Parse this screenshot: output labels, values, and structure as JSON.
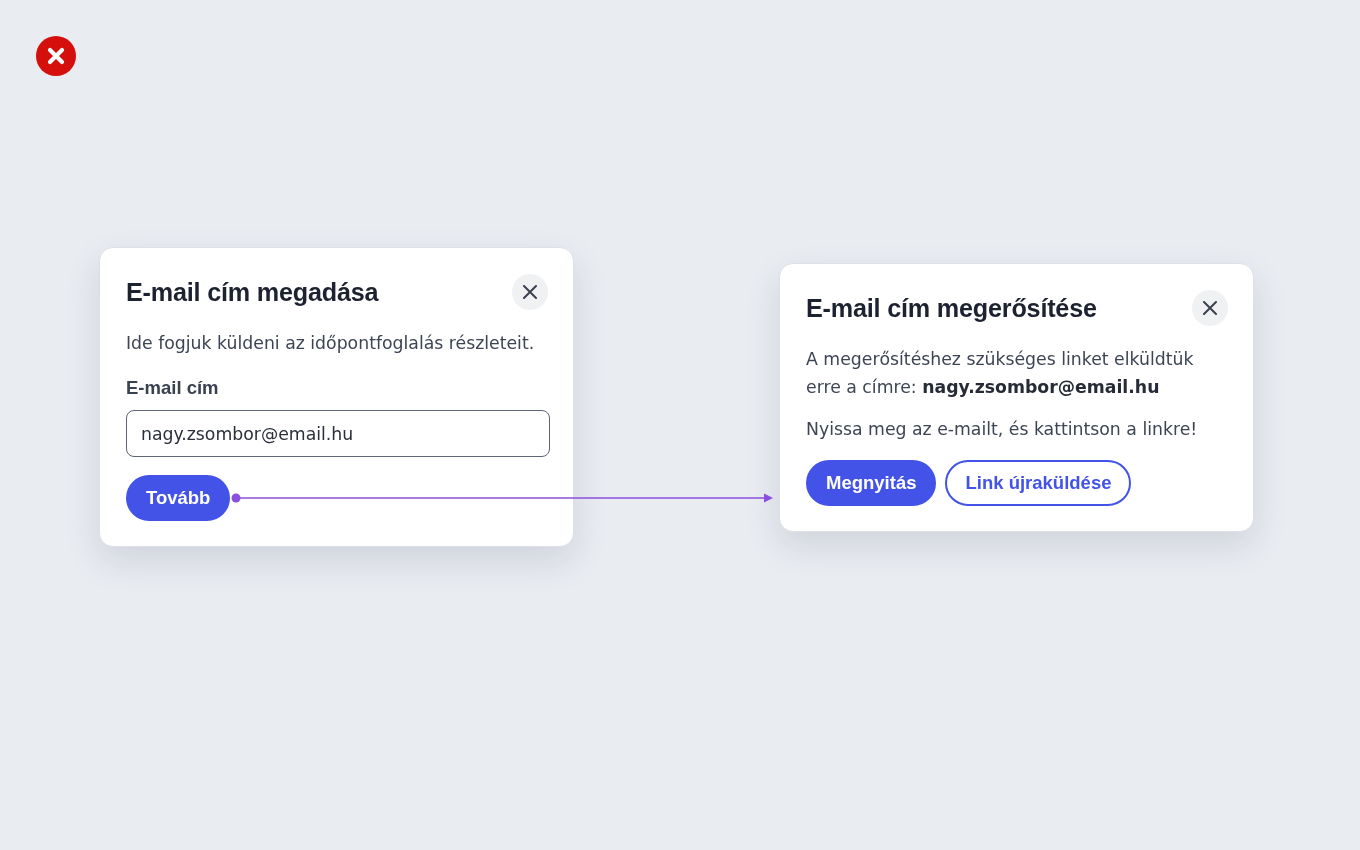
{
  "dialogs": [
    {
      "title": "E-mail cím megadása",
      "paragraphs": [
        "Ide fogjuk küldeni az időpontfoglalás részleteit."
      ],
      "field": {
        "label": "E-mail cím",
        "value": "nagy.zsombor@email.hu"
      },
      "buttons": [
        {
          "label": "Tovább",
          "kind": "primary"
        }
      ]
    },
    {
      "title": "E-mail cím megerősítése",
      "paragraphs": [
        "A megerősítéshez szükséges linket elküldtük erre a címre: **nagy.zsombor@email.hu**",
        "Nyissa meg az e-mailt, és kattintson a linkre!"
      ],
      "buttons": [
        {
          "label": "Megnyitás",
          "kind": "primary"
        },
        {
          "label": "Link újraküldése",
          "kind": "secondary"
        }
      ]
    }
  ]
}
